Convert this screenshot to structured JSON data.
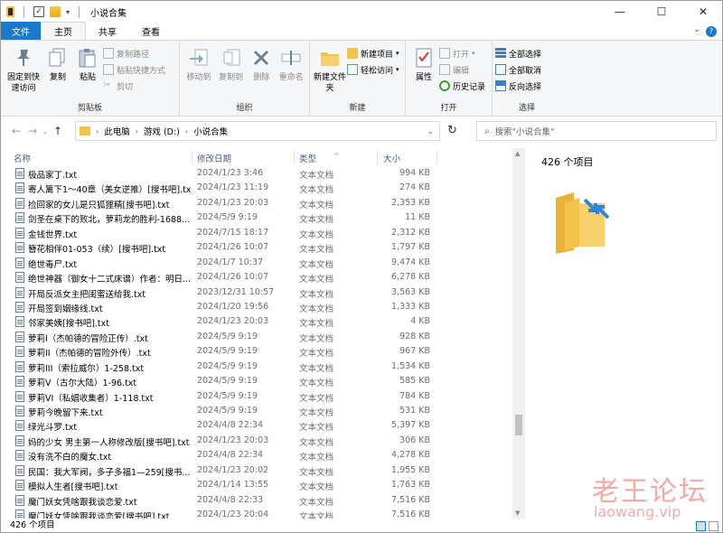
{
  "window": {
    "title": "小说合集",
    "controls": {
      "minimize": "—",
      "maximize": "☐",
      "close": "✕"
    }
  },
  "tabs": [
    {
      "label": "文件"
    },
    {
      "label": "主页"
    },
    {
      "label": "共享"
    },
    {
      "label": "查看"
    }
  ],
  "ribbon": {
    "clipboard": {
      "pin_label": "固定到快速访问",
      "copy_label": "复制",
      "paste_label": "粘贴",
      "copy_path_label": "复制路径",
      "paste_shortcut_label": "粘贴快捷方式",
      "cut_label": "剪切",
      "group_label": "剪贴板"
    },
    "organize": {
      "move_to_label": "移动到",
      "copy_to_label": "复制到",
      "delete_label": "删除",
      "rename_label": "重命名",
      "group_label": "组织"
    },
    "new": {
      "new_folder_label": "新建文件夹",
      "new_item_label": "新建项目",
      "easy_access_label": "轻松访问",
      "group_label": "新建"
    },
    "open": {
      "properties_label": "属性",
      "open_label": "打开",
      "edit_label": "编辑",
      "history_label": "历史记录",
      "group_label": "打开"
    },
    "select": {
      "select_all_label": "全部选择",
      "select_none_label": "全部取消",
      "invert_label": "反向选择",
      "group_label": "选择"
    }
  },
  "address": {
    "crumbs": [
      "此电脑",
      "游戏 (D:)",
      "小说合集"
    ],
    "search_placeholder": "搜索\"小说合集\""
  },
  "columns": {
    "name": "名称",
    "date": "修改日期",
    "type": "类型",
    "size": "大小"
  },
  "files": [
    {
      "name": "极品家丁.txt",
      "date": "2024/1/23 3:46",
      "type": "文本文档",
      "size": "994 KB"
    },
    {
      "name": "寄人篱下1～40章（美女逆推）[搜书吧].txt",
      "date": "2024/1/23 11:19",
      "type": "文本文档",
      "size": "274 KB"
    },
    {
      "name": "捡回家的女儿是只狐狸精[搜书吧].txt",
      "date": "2024/1/23 20:03",
      "type": "文本文档",
      "size": "2,353 KB"
    },
    {
      "name": "剑圣在桌下的败北，萝莉龙的胜利-1688...",
      "date": "2024/5/9 9:19",
      "type": "文本文档",
      "size": "11 KB"
    },
    {
      "name": "金钱世界.txt",
      "date": "2024/7/15 18:17",
      "type": "文本文档",
      "size": "2,312 KB"
    },
    {
      "name": "簪花相伴01-053（续）[搜书吧].txt",
      "date": "2024/1/26 10:07",
      "type": "文本文档",
      "size": "1,797 KB"
    },
    {
      "name": "绝世毒尸.txt",
      "date": "2024/1/7 10:37",
      "type": "文本文档",
      "size": "9,474 KB"
    },
    {
      "name": "绝世神器（御女十二式床谱）作者：明日...",
      "date": "2024/1/26 10:07",
      "type": "文本文档",
      "size": "6,278 KB"
    },
    {
      "name": "开局反派女主把闺蜜送给我.txt",
      "date": "2023/12/31 10:57",
      "type": "文本文档",
      "size": "3,563 KB"
    },
    {
      "name": "开局签到姻缘线.txt",
      "date": "2024/1/20 19:56",
      "type": "文本文档",
      "size": "1,333 KB"
    },
    {
      "name": "邻家美姨[搜书吧].txt",
      "date": "2024/1/23 20:03",
      "type": "文本文档",
      "size": "4 KB"
    },
    {
      "name": "萝莉I（杰帕德的冒险正传）.txt",
      "date": "2024/5/9 9:19",
      "type": "文本文档",
      "size": "928 KB"
    },
    {
      "name": "萝莉II（杰帕德的冒险外传）.txt",
      "date": "2024/5/9 9:19",
      "type": "文本文档",
      "size": "967 KB"
    },
    {
      "name": "萝莉III（索拉威尔）1-258.txt",
      "date": "2024/5/9 9:19",
      "type": "文本文档",
      "size": "1,534 KB"
    },
    {
      "name": "萝莉V（古尔大陆）1-96.txt",
      "date": "2024/5/9 9:19",
      "type": "文本文档",
      "size": "585 KB"
    },
    {
      "name": "萝莉VI（私娼收集者）1-118.txt",
      "date": "2024/5/9 9:19",
      "type": "文本文档",
      "size": "784 KB"
    },
    {
      "name": "萝莉今晚留下来.txt",
      "date": "2024/5/9 9:19",
      "type": "文本文档",
      "size": "531 KB"
    },
    {
      "name": "绿光斗罗.txt",
      "date": "2024/4/8 22:34",
      "type": "文本文档",
      "size": "5,397 KB"
    },
    {
      "name": "妈的少女 男主第一人称修改版[搜书吧].txt",
      "date": "2024/1/23 20:03",
      "type": "文本文档",
      "size": "306 KB"
    },
    {
      "name": "没有洗不白的魔女.txt",
      "date": "2024/4/8 22:34",
      "type": "文本文档",
      "size": "4,278 KB"
    },
    {
      "name": "民国：我大军阀，多子多福1—259[搜书...",
      "date": "2024/1/23 20:02",
      "type": "文本文档",
      "size": "1,955 KB"
    },
    {
      "name": "模拟人生者[搜书吧].txt",
      "date": "2024/1/14 13:55",
      "type": "文本文档",
      "size": "1,763 KB"
    },
    {
      "name": "魔门妖女凭啥跟我谈恋爱.txt",
      "date": "2024/4/8 22:33",
      "type": "文本文档",
      "size": "7,516 KB"
    },
    {
      "name": "魔门妖女凭啥跟我谈恋爱[搜书吧].txt",
      "date": "2024/1/23 20:04",
      "type": "文本文档",
      "size": "7,516 KB"
    }
  ],
  "preview": {
    "count_text": "426 个项目"
  },
  "status": {
    "count_text": "426 个项目"
  },
  "watermark": {
    "line1": "老王论坛",
    "line2": "laowang.vip"
  }
}
